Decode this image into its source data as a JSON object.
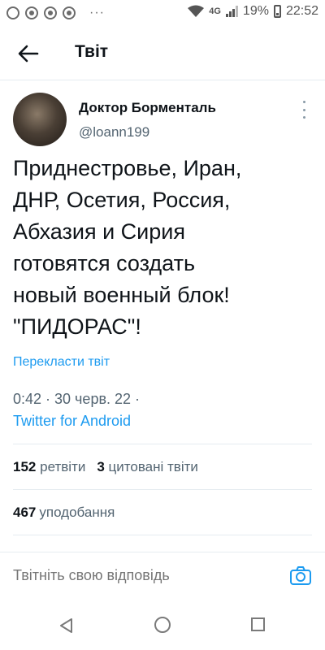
{
  "status_bar": {
    "network": "4G",
    "battery": "19%",
    "time": "22:52",
    "more": "···"
  },
  "header": {
    "title": "Твіт"
  },
  "tweet": {
    "author_name": "Доктор Борменталь",
    "author_handle": "@loann199",
    "text": "Приднестровье, Иран,\nДНР, Осетия, Россия,\nАбхазия и Сирия\nготовятся создать\nновый военный блок!\n\"ПИДОРАС\"!",
    "translate_label": "Перекласти твіт",
    "timestamp": "0:42 · 30 черв. 22 ·",
    "source": "Twitter for Android"
  },
  "stats": {
    "retweets": "152",
    "retweets_label": "ретвіти",
    "quotes": "3",
    "quotes_label": "цитовані твіти",
    "likes": "467",
    "likes_label": "уподобання"
  },
  "reply": {
    "placeholder": "Твітніть свою відповідь"
  },
  "colors": {
    "accent": "#1d9bf0",
    "secondary_text": "#536471",
    "divider": "#e6ecf0"
  },
  "icons": {
    "back": "arrow-left-icon",
    "more": "more-vertical-icon",
    "camera": "camera-icon"
  }
}
